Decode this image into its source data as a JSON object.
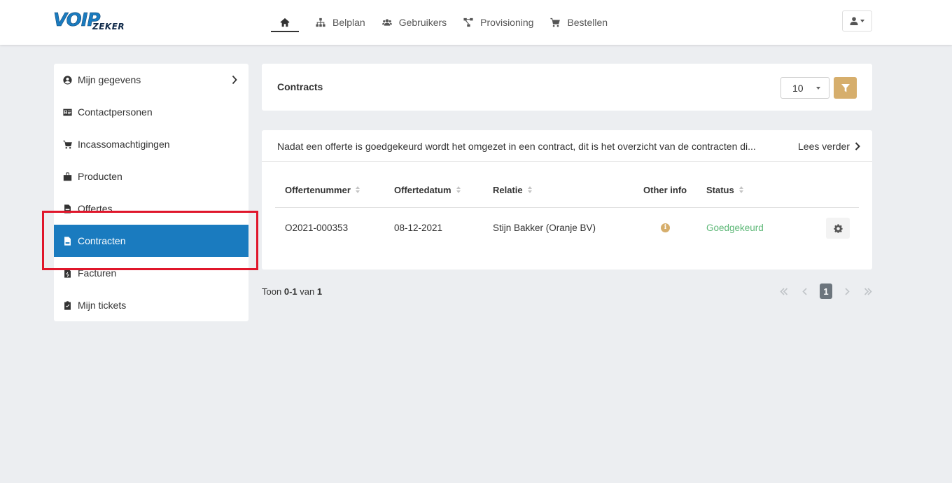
{
  "brand": {
    "logo_main": "VOIP",
    "logo_sub": "ZEKER"
  },
  "nav": {
    "home_icon": "home-icon",
    "items": [
      {
        "label": "Belplan",
        "icon": "sitemap-icon"
      },
      {
        "label": "Gebruikers",
        "icon": "users-icon"
      },
      {
        "label": "Provisioning",
        "icon": "project-diagram-icon"
      },
      {
        "label": "Bestellen",
        "icon": "cart-icon"
      }
    ],
    "user_icon": "user-icon"
  },
  "sidebar": {
    "items": [
      {
        "label": "Mijn gegevens",
        "icon": "user-circle-icon"
      },
      {
        "label": "Contactpersonen",
        "icon": "id-card-icon"
      },
      {
        "label": "Incassomachtigingen",
        "icon": "cart-icon"
      },
      {
        "label": "Producten",
        "icon": "box-icon"
      },
      {
        "label": "Offertes",
        "icon": "file-invoice-icon"
      },
      {
        "label": "Contracten",
        "icon": "file-icon",
        "active": true
      },
      {
        "label": "Facturen",
        "icon": "file-invoice-dollar-icon"
      },
      {
        "label": "Mijn tickets",
        "icon": "clipboard-check-icon"
      }
    ]
  },
  "contracts": {
    "title": "Contracts",
    "page_size": "10",
    "filter_icon": "filter-icon"
  },
  "info": {
    "message": "Nadat een offerte is goedgekeurd wordt het omgezet in een contract, dit is het overzicht van de contracten di...",
    "read_more": "Lees verder"
  },
  "table": {
    "headers": [
      "Offertenummer",
      "Offertedatum",
      "Relatie",
      "Other info",
      "Status"
    ],
    "rows": [
      {
        "offertenummer": "O2021-000353",
        "offertedatum": "08-12-2021",
        "relatie": "Stijn Bakker (Oranje BV)",
        "other_info": "i",
        "status": "Goedgekeurd"
      }
    ]
  },
  "footer": {
    "toon": "Toon",
    "from": "0",
    "dash": "-",
    "to": "1",
    "van": "van",
    "total": "1",
    "current_page": "1"
  },
  "colors": {
    "primary": "#1a7bbf",
    "accent": "#d6ae6c",
    "status_ok": "#5cb776",
    "highlight": "#e0162b"
  }
}
